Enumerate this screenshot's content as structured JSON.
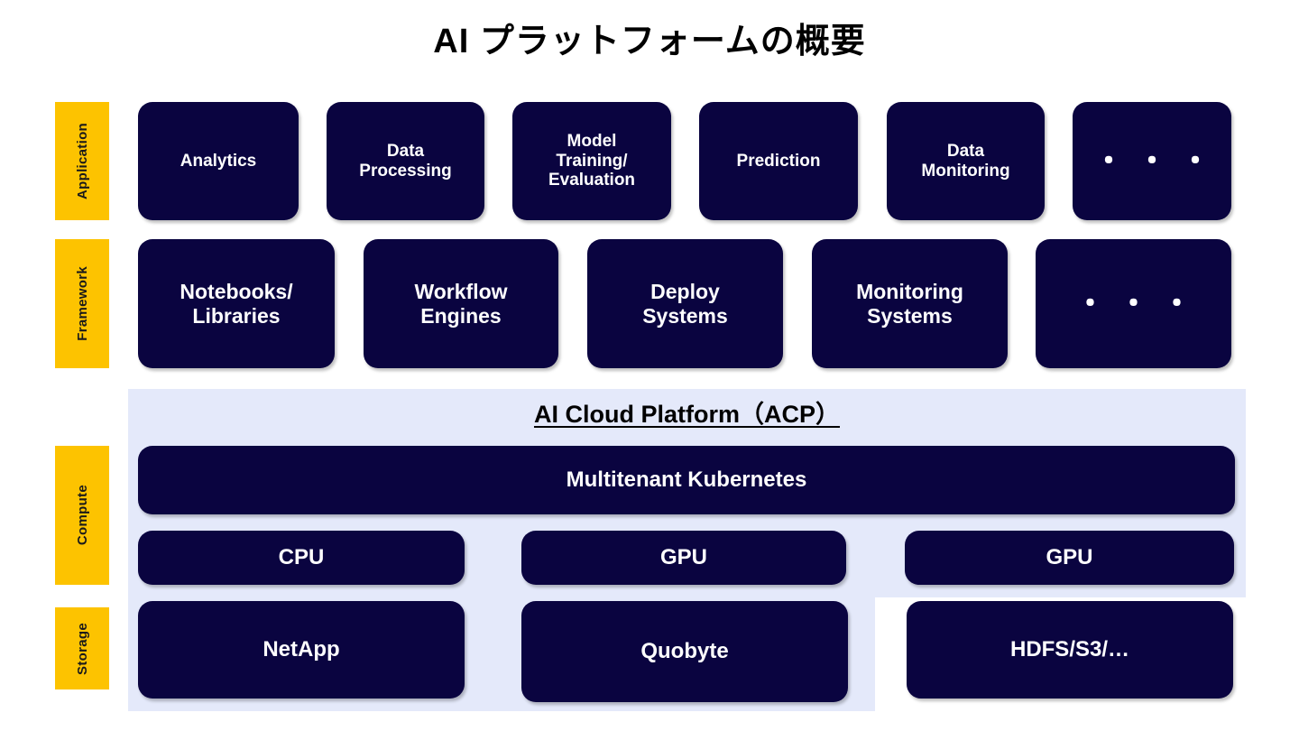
{
  "title": "AI プラットフォームの概要",
  "colors": {
    "node_fill": "#0A0440",
    "node_text": "#FFFFFF",
    "band_fill": "#FDC300",
    "band_text": "#1A1A1A",
    "panel_fill": "#E4E9FA",
    "background": "#FFFFFF",
    "title_text": "#000000"
  },
  "bands": [
    {
      "id": "application",
      "label": "Application"
    },
    {
      "id": "framework",
      "label": "Framework"
    },
    {
      "id": "compute",
      "label": "Compute"
    },
    {
      "id": "storage",
      "label": "Storage"
    }
  ],
  "platform": {
    "label": "AI Cloud Platform（ACP）"
  },
  "layers": {
    "application": {
      "nodes": [
        {
          "label": "Analytics"
        },
        {
          "label": "Data\nProcessing"
        },
        {
          "label": "Model\nTraining/\nEvaluation"
        },
        {
          "label": "Prediction"
        },
        {
          "label": "Data\nMonitoring"
        },
        {
          "label": "・・・"
        }
      ]
    },
    "framework": {
      "nodes": [
        {
          "label": "Notebooks/\nLibraries"
        },
        {
          "label": "Workflow\nEngines"
        },
        {
          "label": "Deploy\nSystems"
        },
        {
          "label": "Monitoring\nSystems"
        },
        {
          "label": "・・・"
        }
      ]
    },
    "compute": {
      "orchestrator": {
        "label": "Multitenant Kubernetes"
      },
      "processors": [
        {
          "label": "CPU"
        },
        {
          "label": "GPU"
        },
        {
          "label": "GPU"
        }
      ]
    },
    "storage": {
      "nodes": [
        {
          "label": "NetApp"
        },
        {
          "label": "Quobyte"
        },
        {
          "label": "HDFS/S3/…"
        }
      ]
    }
  }
}
